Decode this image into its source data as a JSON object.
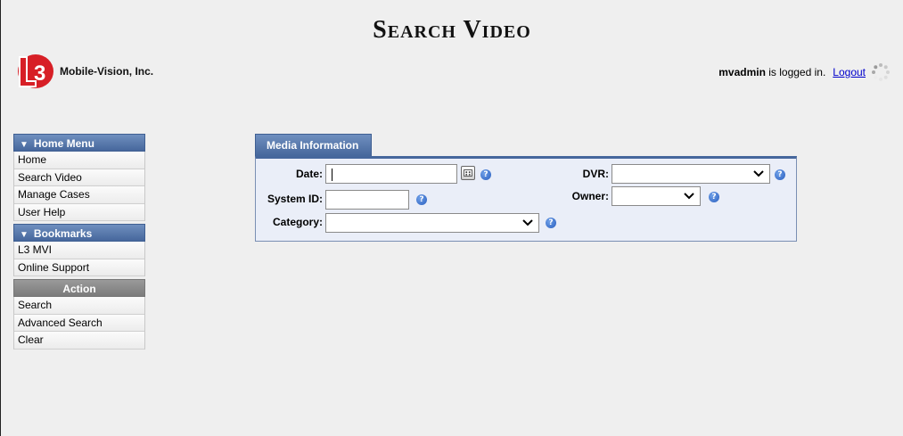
{
  "header": {
    "title": "Search Video",
    "company": "Mobile-Vision, Inc.",
    "user": "mvadmin",
    "login_suffix": " is logged in.",
    "logout_label": "Logout"
  },
  "sidebar": {
    "home_menu": {
      "title": "Home Menu",
      "items": [
        "Home",
        "Search Video",
        "Manage Cases",
        "User Help"
      ]
    },
    "bookmarks": {
      "title": "Bookmarks",
      "items": [
        "L3 MVI",
        "Online Support"
      ]
    },
    "action": {
      "title": "Action",
      "items": [
        "Search",
        "Advanced Search",
        "Clear"
      ]
    }
  },
  "form": {
    "tab_label": "Media Information",
    "date_label": "Date:",
    "date_value": "",
    "system_id_label": "System ID:",
    "system_id_value": "",
    "category_label": "Category:",
    "category_value": "",
    "dvr_label": "DVR:",
    "dvr_value": "",
    "owner_label": "Owner:",
    "owner_value": ""
  },
  "colors": {
    "menu_header": "#46679c",
    "action_header": "#7b7b7b",
    "link": "#0000cc",
    "form_bg": "#eaeef8"
  }
}
